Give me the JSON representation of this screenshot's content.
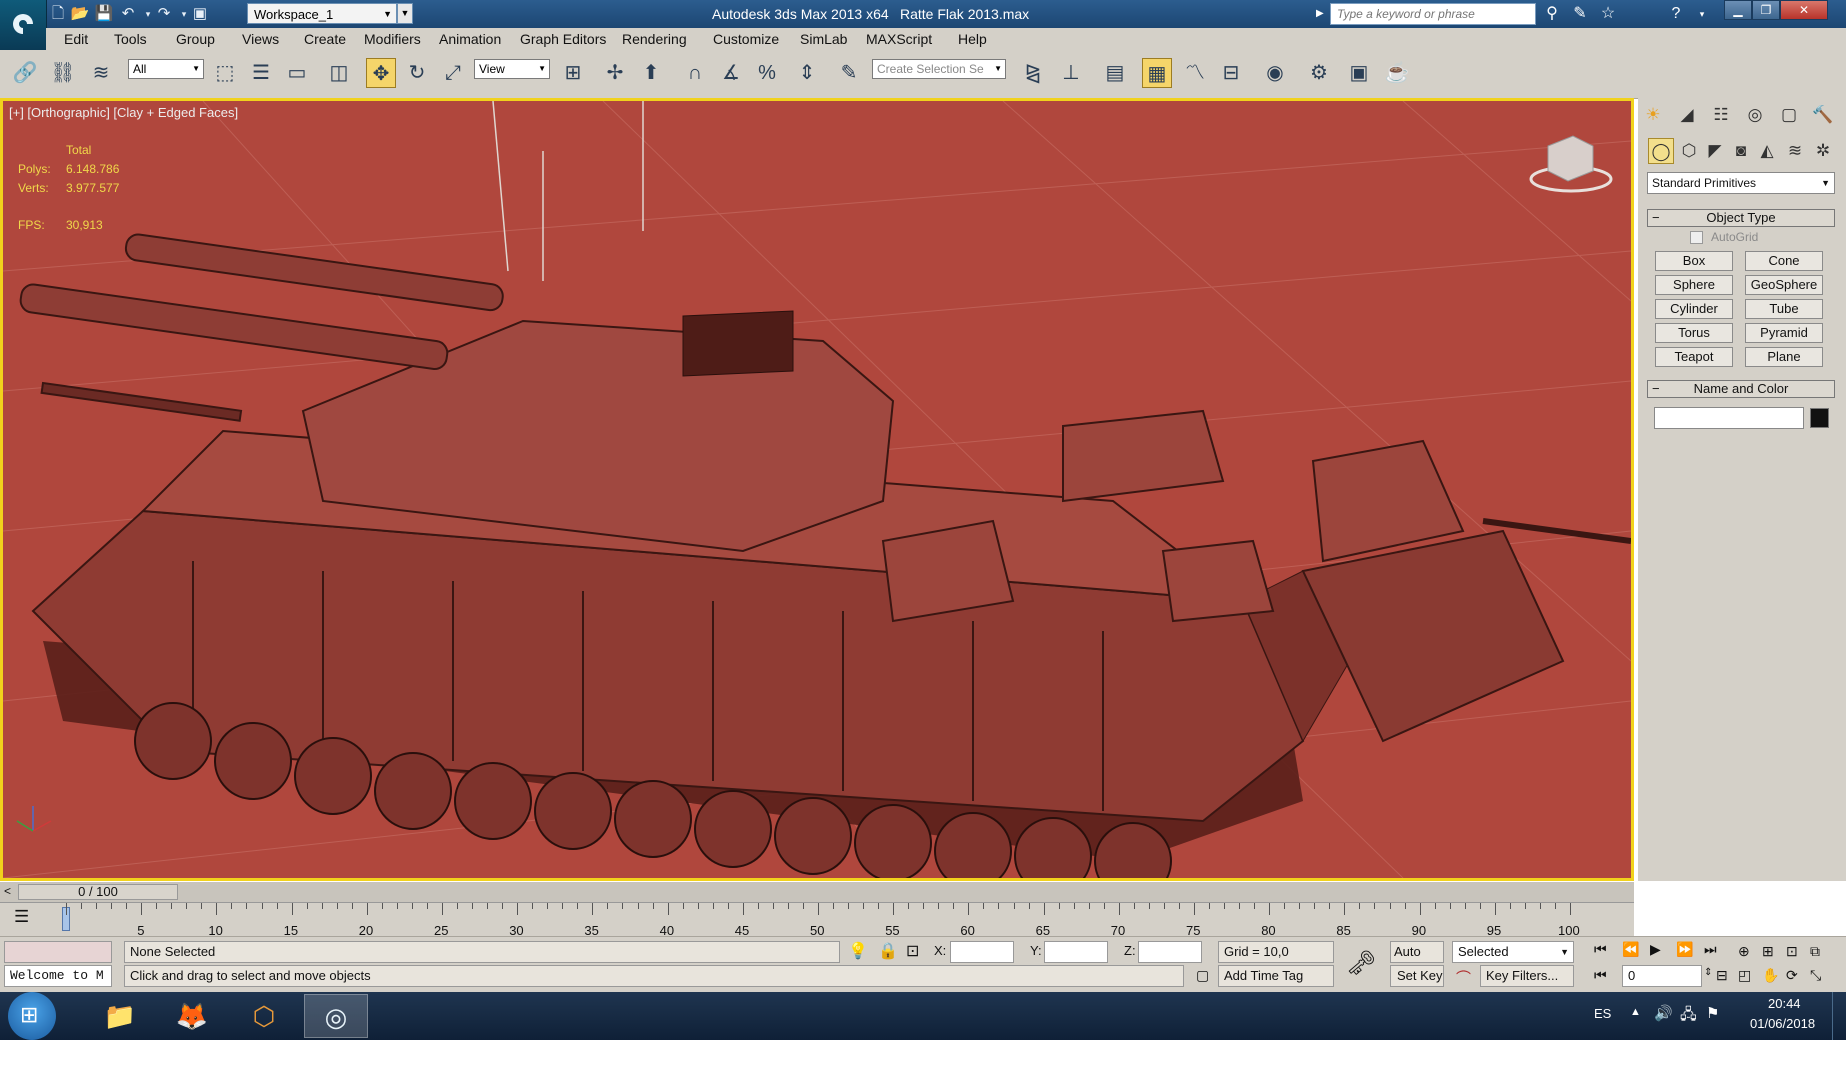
{
  "titlebar": {
    "workspace": "Workspace_1",
    "app_title": "Autodesk 3ds Max  2013 x64",
    "file_title": "Ratte Flak 2013.max",
    "search_placeholder": "Type a keyword or phrase"
  },
  "menu": [
    "Edit",
    "Tools",
    "Group",
    "Views",
    "Create",
    "Modifiers",
    "Animation",
    "Graph Editors",
    "Rendering",
    "Customize",
    "SimLab",
    "MAXScript",
    "Help"
  ],
  "toolbar": {
    "filter_value": "All",
    "refcoord_value": "View",
    "selection_set_placeholder": "Create Selection Se"
  },
  "viewport": {
    "label": "[+] [Orthographic] [Clay + Edged Faces]",
    "stats_total": "Total",
    "polys_label": "Polys:",
    "polys_value": "6.148.786",
    "verts_label": "Verts:",
    "verts_value": "3.977.577",
    "fps_label": "FPS:",
    "fps_value": "30,913",
    "bg_color": "#b0473d",
    "border_color": "#f1d21c"
  },
  "command_panel": {
    "category": "Standard Primitives",
    "object_type_title": "Object Type",
    "autogrid_label": "AutoGrid",
    "buttons": [
      "Box",
      "Cone",
      "Sphere",
      "GeoSphere",
      "Cylinder",
      "Tube",
      "Torus",
      "Pyramid",
      "Teapot",
      "Plane"
    ],
    "name_color_title": "Name and Color",
    "object_color": "#111111"
  },
  "timeline": {
    "frame_display": "0 / 100",
    "ticks": [
      "5",
      "10",
      "15",
      "20",
      "25",
      "30",
      "35",
      "40",
      "45",
      "50",
      "55",
      "60",
      "65",
      "70",
      "75",
      "80",
      "85",
      "90",
      "95",
      "100"
    ]
  },
  "status": {
    "maxscript_prompt": "Welcome to M",
    "selection_status": "None Selected",
    "prompt_text": "Click and drag to select and move objects",
    "x_label": "X:",
    "y_label": "Y:",
    "z_label": "Z:",
    "grid": "Grid = 10,0",
    "add_time_tag": "Add Time Tag",
    "auto_key": "Auto Key",
    "set_key": "Set Key",
    "selected_dropdown": "Selected",
    "key_filters": "Key Filters...",
    "current_frame": "0"
  },
  "taskbar": {
    "language": "ES",
    "time": "20:44",
    "date": "01/06/2018"
  }
}
